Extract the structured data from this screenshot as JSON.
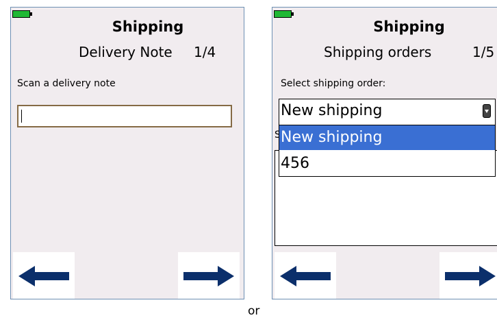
{
  "screen1": {
    "title": "Shipping",
    "subtitle": "Delivery Note",
    "step": "1/4",
    "prompt": "Scan a delivery note",
    "input_value": ""
  },
  "screen2": {
    "title": "Shipping",
    "subtitle": "Shipping orders",
    "step": "1/5",
    "prompt": "Select shipping order:",
    "select_value": "New shipping",
    "hidden_label": "S",
    "options": [
      "New shipping",
      "456"
    ]
  },
  "or_text": "or",
  "icons": {
    "battery": "battery-icon",
    "back": "arrow-left-icon",
    "next": "arrow-right-icon",
    "dropdown": "chevron-down-icon"
  },
  "colors": {
    "arrow": "#0b2f6b",
    "selected": "#3a6fd3",
    "battery": "#1fb834",
    "background": "#f1ecef",
    "input_border": "#856a44"
  }
}
